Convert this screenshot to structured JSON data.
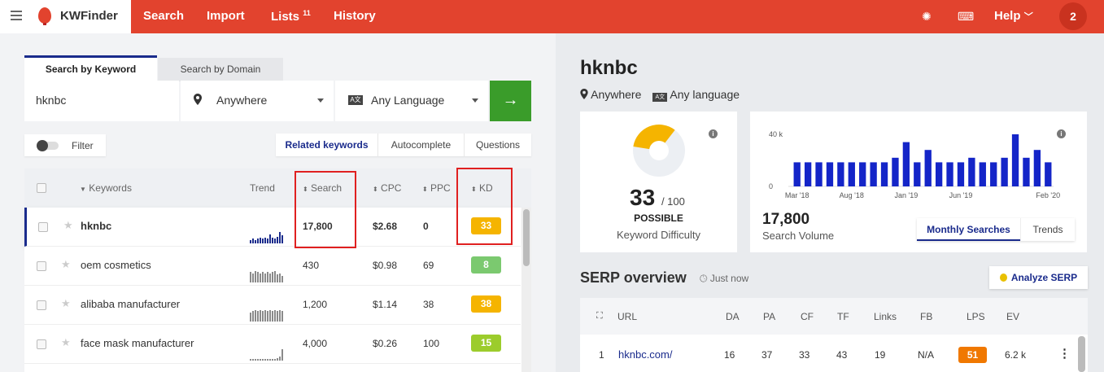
{
  "app": {
    "name": "KWFinder"
  },
  "nav": {
    "items": [
      "Search",
      "Import",
      "Lists",
      "History"
    ],
    "lists_badge": "11",
    "help": "Help",
    "notifications_count": "2"
  },
  "search": {
    "tabs": [
      "Search by Keyword",
      "Search by Domain"
    ],
    "keyword_value": "hknbc",
    "location": "Anywhere",
    "language": "Any Language",
    "go_arrow": "→"
  },
  "filter": {
    "label": "Filter"
  },
  "subtabs": [
    "Related keywords",
    "Autocomplete",
    "Questions"
  ],
  "table": {
    "columns": {
      "keywords": "Keywords",
      "trend": "Trend",
      "search": "Search",
      "cpc": "CPC",
      "ppc": "PPC",
      "kd": "KD"
    },
    "rows": [
      {
        "keyword": "hknbc",
        "search": "17,800",
        "cpc": "$2.68",
        "ppc": "0",
        "kd": "33",
        "kd_color": "#f5b400",
        "trend": [
          3,
          4,
          3,
          4,
          5,
          4,
          5,
          4,
          8,
          5,
          4,
          6,
          10,
          7
        ]
      },
      {
        "keyword": "oem cosmetics",
        "search": "430",
        "cpc": "$0.98",
        "ppc": "69",
        "kd": "8",
        "kd_color": "#7bc96f",
        "trend": [
          9,
          8,
          10,
          9,
          8,
          9,
          8,
          9,
          8,
          9,
          10,
          7,
          8,
          6
        ]
      },
      {
        "keyword": "alibaba manufacturer",
        "search": "1,200",
        "cpc": "$1.14",
        "ppc": "38",
        "kd": "38",
        "kd_color": "#f5b400",
        "trend": [
          8,
          9,
          10,
          9,
          10,
          9,
          10,
          9,
          10,
          9,
          10,
          9,
          10,
          9
        ]
      },
      {
        "keyword": "face mask manufacturer",
        "search": "4,000",
        "cpc": "$0.26",
        "ppc": "100",
        "kd": "15",
        "kd_color": "#9ccc2c",
        "trend": [
          1,
          1,
          1,
          1,
          1,
          1,
          1,
          1,
          1,
          1,
          1,
          2,
          3,
          9
        ]
      }
    ]
  },
  "detail": {
    "keyword": "hknbc",
    "location": "Anywhere",
    "language": "Any language",
    "kd_value": "33",
    "kd_max": "/ 100",
    "kd_fraction": 0.33,
    "kd_verdict": "POSSIBLE",
    "kd_label": "Keyword Difficulty",
    "volume": "17,800",
    "volume_label": "Search Volume",
    "volume_tabs": [
      "Monthly Searches",
      "Trends"
    ]
  },
  "chart_data": {
    "type": "bar",
    "categories": [
      "Mar '18",
      "Apr '18",
      "May '18",
      "Jun '18",
      "Jul '18",
      "Aug '18",
      "Sep '18",
      "Oct '18",
      "Nov '18",
      "Dec '18",
      "Jan '19",
      "Feb '19",
      "Mar '19",
      "Apr '19",
      "May '19",
      "Jun '19",
      "Jul '19",
      "Aug '19",
      "Sep '19",
      "Oct '19",
      "Nov '19",
      "Dec '19",
      "Jan '20",
      "Feb '20"
    ],
    "values": [
      18500,
      18500,
      18500,
      18500,
      18500,
      18500,
      18500,
      18500,
      18500,
      22000,
      34000,
      18500,
      28000,
      18500,
      18500,
      18500,
      22000,
      18500,
      18500,
      22000,
      40000,
      22000,
      28000,
      18500
    ],
    "tick_labels": [
      "Mar '18",
      "Aug '18",
      "Jan '19",
      "Jun '19",
      "Feb '20"
    ],
    "ytick_labels": [
      "40 k",
      "0"
    ],
    "ylim": [
      0,
      40000
    ],
    "color": "#1425c8"
  },
  "serp": {
    "title": "SERP overview",
    "time": "Just now",
    "analyze": "Analyze SERP",
    "columns": [
      "URL",
      "DA",
      "PA",
      "CF",
      "TF",
      "Links",
      "FB",
      "LPS",
      "EV"
    ],
    "row": {
      "rank": "1",
      "url": "hknbc.com/",
      "da": "16",
      "pa": "37",
      "cf": "33",
      "tf": "43",
      "links": "19",
      "fb": "N/A",
      "lps": "51",
      "ev": "6.2 k"
    }
  }
}
